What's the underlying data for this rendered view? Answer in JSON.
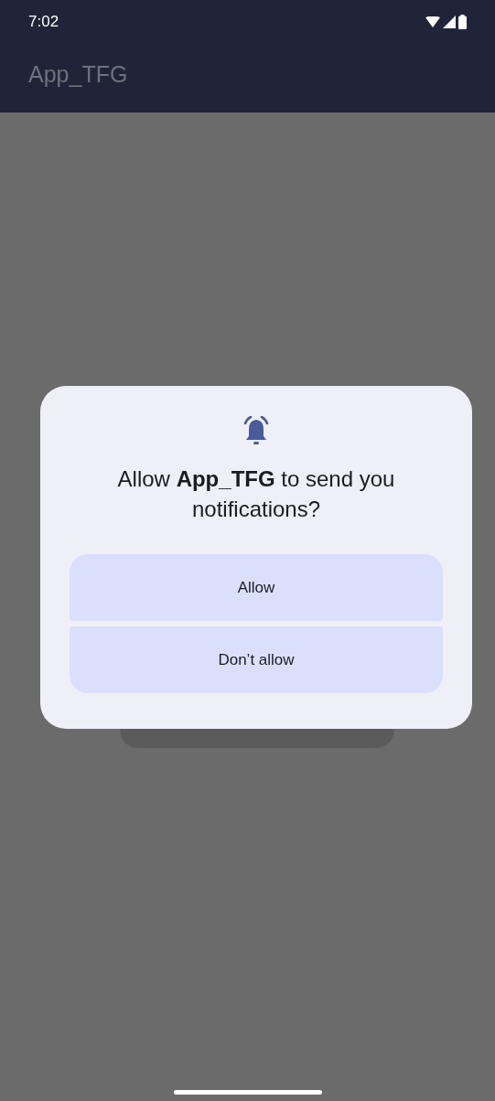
{
  "status_bar": {
    "time": "7:02"
  },
  "app_bar": {
    "title": "App_TFG"
  },
  "dialog": {
    "message": "Allow **App_TFG** to send you notifications?",
    "buttons": [
      {
        "label": "Allow"
      },
      {
        "label": "Don’t allow"
      }
    ]
  }
}
